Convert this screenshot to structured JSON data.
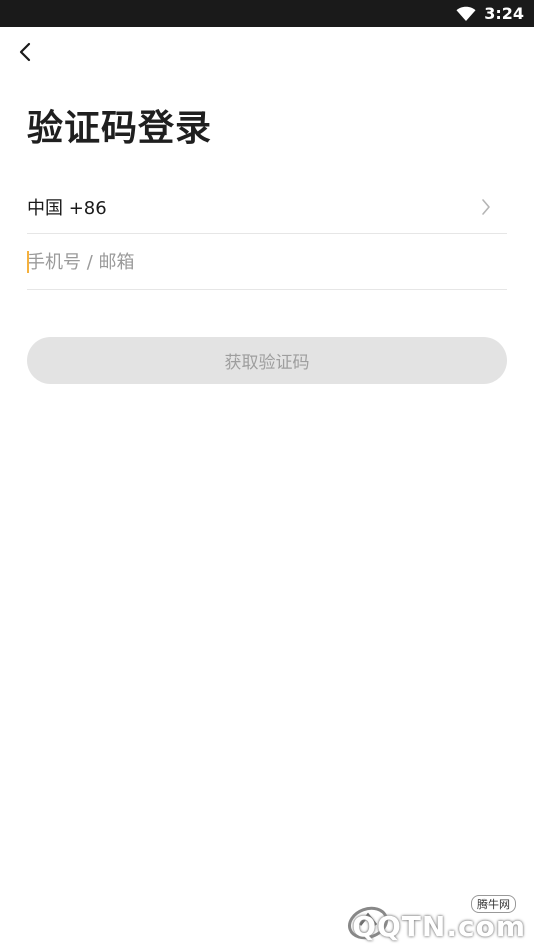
{
  "status_bar": {
    "time": "3:24",
    "wifi_icon": "wifi-icon"
  },
  "header": {
    "back_icon": "chevron-left-icon"
  },
  "title": "验证码登录",
  "country": {
    "label": "中国 +86",
    "chevron_icon": "chevron-right-icon"
  },
  "account_input": {
    "value": "",
    "placeholder": "手机号 / 邮箱"
  },
  "get_code_button": {
    "label": "获取验证码",
    "enabled": false
  },
  "watermark": {
    "text": "QQTN.com",
    "small_text": "腾牛网"
  },
  "colors": {
    "accent_caret": "#f5b13d",
    "button_disabled_bg": "#e3e3e3",
    "button_disabled_text": "#9e9e9e",
    "status_bar_bg": "#1a1a1a"
  }
}
